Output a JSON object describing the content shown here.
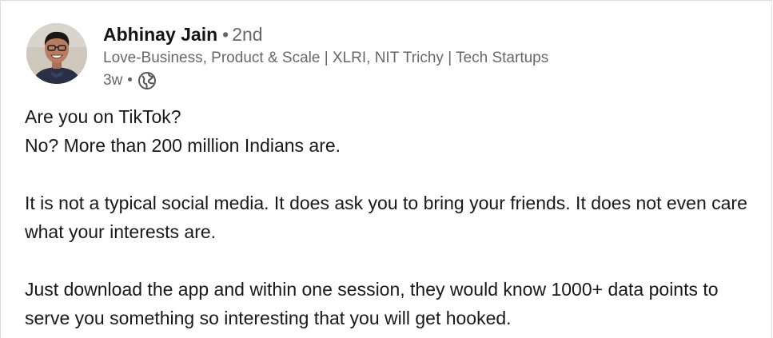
{
  "post": {
    "author": {
      "name": "Abhinay Jain",
      "separator": "•",
      "degree": "2nd",
      "headline": "Love-Business, Product & Scale | XLRI, NIT Trichy | Tech Startups",
      "time": "3w",
      "time_separator": "•",
      "visibility_icon": "globe-icon",
      "avatar_icon": "profile-photo"
    },
    "content": {
      "p1_line1": "Are you on TikTok?",
      "p1_line2": "No? More than 200 million Indians are.",
      "p2": "It is not a typical social media. It does ask you to bring your friends. It does not even care what your interests are.",
      "p3": "Just download the app and within one session, they would know 1000+ data points to serve you something so interesting that you will get hooked."
    }
  },
  "colors": {
    "text_primary": "#191919",
    "text_secondary": "#666666",
    "border": "#dcdcdc",
    "background": "#ffffff"
  }
}
